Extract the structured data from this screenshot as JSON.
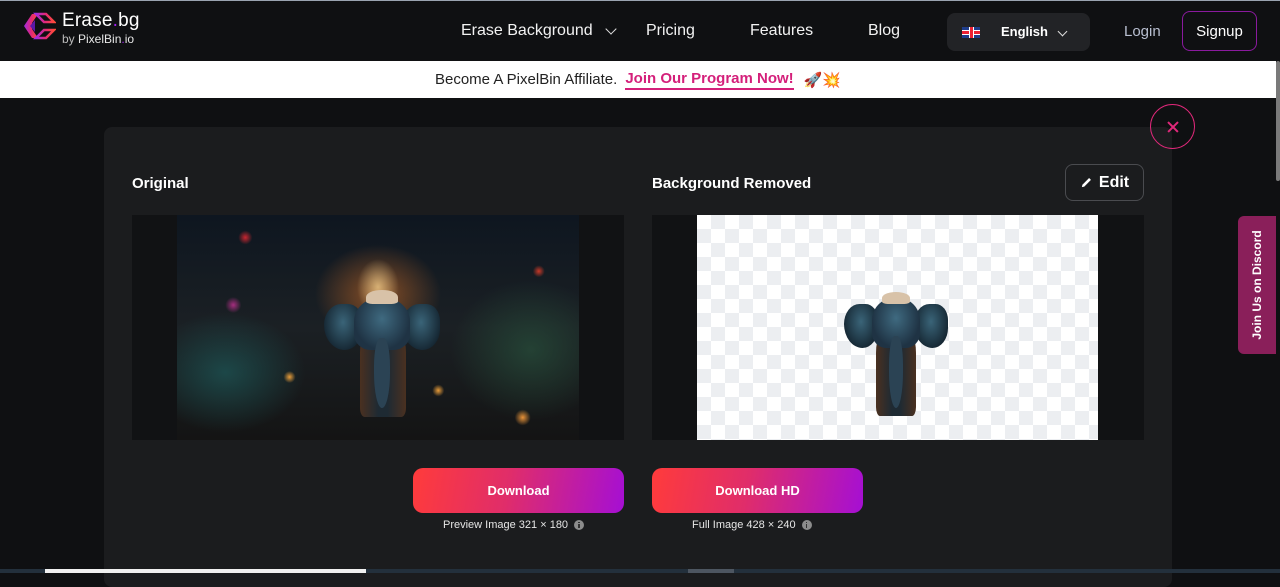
{
  "header": {
    "logo": {
      "title_main": "Erase",
      "title_dot": ".",
      "title_ext": "bg",
      "sub_by": "by ",
      "sub_brand": "PixelBin",
      "sub_dot": ".",
      "sub_ext": "io"
    },
    "nav": [
      {
        "label": "Erase Background",
        "has_dropdown": true
      },
      {
        "label": "Pricing"
      },
      {
        "label": "Features"
      },
      {
        "label": "Blog"
      }
    ],
    "language": {
      "flag": "uk-flag-icon",
      "selected": "English"
    },
    "login_label": "Login",
    "signup_label": "Signup"
  },
  "banner": {
    "text": "Become A PixelBin Affiliate.",
    "link_label": "Join Our Program Now!",
    "emoji": "🚀💥"
  },
  "modal": {
    "original_title": "Original",
    "removed_title": "Background Removed",
    "edit_label": "Edit",
    "download": {
      "label": "Download",
      "caption": "Preview Image 321 × 180"
    },
    "download_hd": {
      "label": "Download HD",
      "caption": "Full Image 428 × 240"
    }
  },
  "discord_label": "Join Us on Discord",
  "colors": {
    "accent_pink": "#e0287a",
    "signup_border": "#8a1a9e",
    "discord_bg": "#8a1f5a",
    "gradient_start": "#ff3b3b",
    "gradient_end": "#a50fd4"
  }
}
